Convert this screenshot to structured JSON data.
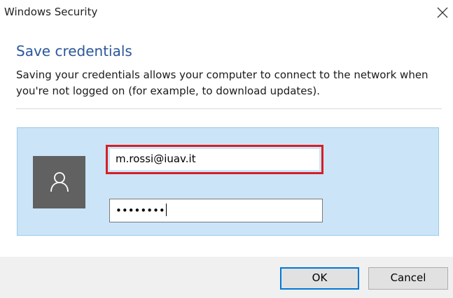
{
  "window": {
    "title": "Windows Security"
  },
  "dialog": {
    "heading": "Save credentials",
    "description": "Saving your credentials allows your computer to connect to the network when you're not logged on (for example, to download updates)."
  },
  "credentials": {
    "username_value": "m.rossi@iuav.it",
    "password_value": "••••••••",
    "avatar_icon": "user-icon"
  },
  "buttons": {
    "ok_label": "OK",
    "cancel_label": "Cancel"
  },
  "colors": {
    "accent": "#2b579a",
    "panel_background": "#cce4f7",
    "highlight_border": "#d42027",
    "focus_border": "#0078d7"
  }
}
